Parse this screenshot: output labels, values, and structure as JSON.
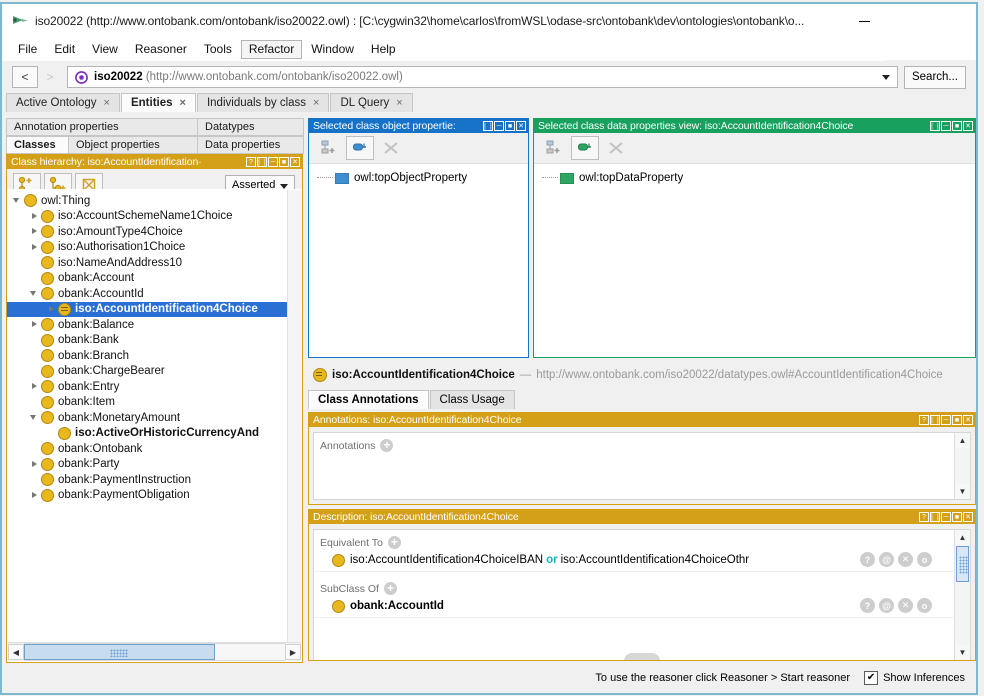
{
  "window": {
    "title": "iso20022 (http://www.ontobank.com/ontobank/iso20022.owl)  : [C:\\cygwin32\\home\\carlos\\fromWSL\\odase-src\\ontobank\\dev\\ontologies\\ontobank\\o...",
    "minimize_label": "—"
  },
  "menu": {
    "items": [
      {
        "label": "File",
        "active": false
      },
      {
        "label": "Edit",
        "active": false
      },
      {
        "label": "View",
        "active": false
      },
      {
        "label": "Reasoner",
        "active": false
      },
      {
        "label": "Tools",
        "active": false
      },
      {
        "label": "Refactor",
        "active": true
      },
      {
        "label": "Window",
        "active": false
      },
      {
        "label": "Help",
        "active": false
      }
    ]
  },
  "toolbar": {
    "back_label": "<",
    "forward_label": ">",
    "ontology_name": "iso20022",
    "ontology_iri": "(http://www.ontobank.com/ontobank/iso20022.owl)",
    "search_label": "Search..."
  },
  "main_tabs": [
    {
      "label": "Active Ontology",
      "selected": false,
      "close": "×"
    },
    {
      "label": "Entities",
      "selected": true,
      "close": "×"
    },
    {
      "label": "Individuals by class",
      "selected": false,
      "close": "×"
    },
    {
      "label": "DL Query",
      "selected": false,
      "close": "×"
    }
  ],
  "entity_subtabs": {
    "row1": [
      {
        "label": "Annotation properties",
        "selected": false
      },
      {
        "label": "Datatypes",
        "selected": false
      }
    ],
    "row2": [
      {
        "label": "Classes",
        "selected": true
      },
      {
        "label": "Object properties",
        "selected": false
      },
      {
        "label": "Data properties",
        "selected": false
      }
    ]
  },
  "class_hierarchy": {
    "header": "Class hierarchy: iso:AccountIdentification·",
    "header_buttons": [
      "?",
      "❘❘",
      "─",
      "■",
      "✕"
    ],
    "toolbar_icons": [
      "add-subclass-icon",
      "add-sibling-class-icon",
      "delete-class-icon"
    ],
    "view_mode": "Asserted",
    "nodes": [
      {
        "label": "owl:Thing",
        "depth": 0,
        "arrow": "down",
        "selected": false,
        "bold": false,
        "icon": "class-dot"
      },
      {
        "label": "iso:AccountSchemeName1Choice",
        "depth": 1,
        "arrow": "right",
        "selected": false,
        "bold": false,
        "icon": "class-dot"
      },
      {
        "label": "iso:AmountType4Choice",
        "depth": 1,
        "arrow": "right",
        "selected": false,
        "bold": false,
        "icon": "class-dot"
      },
      {
        "label": "iso:Authorisation1Choice",
        "depth": 1,
        "arrow": "right",
        "selected": false,
        "bold": false,
        "icon": "class-dot"
      },
      {
        "label": "iso:NameAndAddress10",
        "depth": 1,
        "arrow": "none",
        "selected": false,
        "bold": false,
        "icon": "class-dot"
      },
      {
        "label": "obank:Account",
        "depth": 1,
        "arrow": "none",
        "selected": false,
        "bold": false,
        "icon": "class-dot"
      },
      {
        "label": "obank:AccountId",
        "depth": 1,
        "arrow": "down",
        "selected": false,
        "bold": false,
        "icon": "class-dot"
      },
      {
        "label": "iso:AccountIdentification4Choice",
        "depth": 2,
        "arrow": "right",
        "selected": true,
        "bold": true,
        "icon": "defined-class-dot"
      },
      {
        "label": "obank:Balance",
        "depth": 1,
        "arrow": "right",
        "selected": false,
        "bold": false,
        "icon": "class-dot"
      },
      {
        "label": "obank:Bank",
        "depth": 1,
        "arrow": "none",
        "selected": false,
        "bold": false,
        "icon": "class-dot"
      },
      {
        "label": "obank:Branch",
        "depth": 1,
        "arrow": "none",
        "selected": false,
        "bold": false,
        "icon": "class-dot"
      },
      {
        "label": "obank:ChargeBearer",
        "depth": 1,
        "arrow": "none",
        "selected": false,
        "bold": false,
        "icon": "class-dot"
      },
      {
        "label": "obank:Entry",
        "depth": 1,
        "arrow": "right",
        "selected": false,
        "bold": false,
        "icon": "class-dot"
      },
      {
        "label": "obank:Item",
        "depth": 1,
        "arrow": "none",
        "selected": false,
        "bold": false,
        "icon": "class-dot"
      },
      {
        "label": "obank:MonetaryAmount",
        "depth": 1,
        "arrow": "down",
        "selected": false,
        "bold": false,
        "icon": "class-dot"
      },
      {
        "label": "iso:ActiveOrHistoricCurrencyAnd",
        "depth": 2,
        "arrow": "none",
        "selected": false,
        "bold": true,
        "icon": "class-dot"
      },
      {
        "label": "obank:Ontobank",
        "depth": 1,
        "arrow": "none",
        "selected": false,
        "bold": false,
        "icon": "class-dot"
      },
      {
        "label": "obank:Party",
        "depth": 1,
        "arrow": "right",
        "selected": false,
        "bold": false,
        "icon": "class-dot"
      },
      {
        "label": "obank:PaymentInstruction",
        "depth": 1,
        "arrow": "none",
        "selected": false,
        "bold": false,
        "icon": "class-dot"
      },
      {
        "label": "obank:PaymentObligation",
        "depth": 1,
        "arrow": "right",
        "selected": false,
        "bold": false,
        "icon": "class-dot"
      }
    ]
  },
  "object_properties_view": {
    "header": "Selected class object propertie:",
    "header_buttons": [
      "❘❘",
      "─",
      "■",
      "✕"
    ],
    "items": [
      {
        "label": "owl:topObjectProperty",
        "color": "#3f8fd0"
      }
    ]
  },
  "data_properties_view": {
    "header": "Selected class data properties view: iso:AccountIdentification4Choice",
    "header_buttons": [
      "❘❘",
      "─",
      "■",
      "✕"
    ],
    "items": [
      {
        "label": "owl:topDataProperty",
        "color": "#2fa564"
      }
    ]
  },
  "entity_header": {
    "name": "iso:AccountIdentification4Choice",
    "dash": "—",
    "iri": "http://www.ontobank.com/iso20022/datatypes.owl#AccountIdentification4Choice"
  },
  "class_tabs": [
    {
      "label": "Class Annotations",
      "selected": true
    },
    {
      "label": "Class Usage",
      "selected": false
    }
  ],
  "annotations_panel": {
    "header": "Annotations: iso:AccountIdentification4Choice",
    "header_buttons": [
      "?",
      "❘❘",
      "─",
      "■",
      "✕"
    ],
    "section_label": "Annotations",
    "add_label": "+"
  },
  "description_panel": {
    "header": "Description: iso:AccountIdentification4Choice",
    "header_buttons": [
      "?",
      "❘❘",
      "─",
      "■",
      "✕"
    ],
    "sections": [
      {
        "label": "Equivalent To",
        "add_label": "+",
        "rows": [
          {
            "parts": [
              {
                "text": "iso:AccountIdentification4ChoiceIBAN",
                "kind": "entity"
              },
              {
                "text": "or",
                "kind": "keyword"
              },
              {
                "text": "iso:AccountIdentification4ChoiceOthr",
                "kind": "entity"
              }
            ],
            "bold": false,
            "actions": [
              "?",
              "@",
              "✕",
              "o"
            ]
          }
        ]
      },
      {
        "label": "SubClass Of",
        "add_label": "+",
        "rows": [
          {
            "parts": [
              {
                "text": "obank:AccountId",
                "kind": "entity"
              }
            ],
            "bold": true,
            "actions": [
              "?",
              "@",
              "✕",
              "o"
            ]
          }
        ]
      }
    ]
  },
  "status_bar": {
    "message": "To use the reasoner click Reasoner > Start reasoner",
    "checkbox_checked": true,
    "checkbox_mark": "✔",
    "checkbox_label": "Show Inferences"
  },
  "colors": {
    "yellow_header": "#d4a017",
    "blue_header": "#1572c7",
    "green_header": "#17a05e",
    "selection_blue": "#2a6fd4",
    "frame_teal": "#7fb8cc",
    "keyword_cyan": "#19b2c8"
  }
}
